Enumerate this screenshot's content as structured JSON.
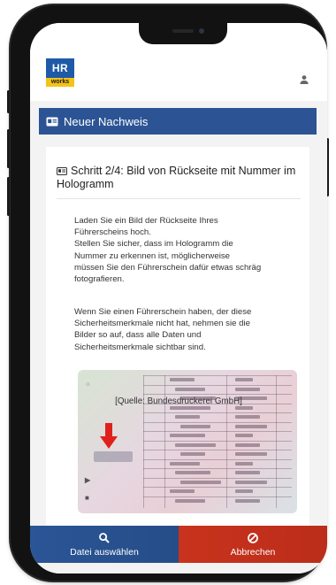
{
  "app": {
    "logo": {
      "top_text": "HR",
      "bottom_text": "works",
      "blue": "#1e5aa8",
      "yellow": "#f3c316"
    },
    "user_icon": "user-icon"
  },
  "section": {
    "title": "Neuer Nachweis",
    "icon": "id-card-icon",
    "color": "#2c5494"
  },
  "step": {
    "title": "Schritt 2/4: Bild von Rückseite mit Nummer im Hologramm",
    "icon": "id-card-icon",
    "paragraph1": "Laden Sie ein Bild der Rückseite Ihres\nFührerscheins hoch.\nStellen Sie sicher, dass im Hologramm die\nNummer zu erkennen ist, möglicherweise\nmüssen Sie den Führerschein dafür etwas schräg\nfotografieren.",
    "paragraph2": "Wenn Sie einen Führerschein haben, der diese\nSicherheitsmerkmale nicht hat, nehmen sie die\nBilder so auf, dass alle Daten und\nSicherheitsmerkmale sichtbar sind.",
    "image": "license-back-image",
    "caption": "[Quelle: Bundesdruckerei GmbH]"
  },
  "buttons": {
    "file": {
      "label": "Datei auswählen",
      "icon": "search-icon",
      "color": "#2a5596"
    },
    "cancel": {
      "label": "Abbrechen",
      "icon": "cancel-icon",
      "color": "#c8331d"
    }
  }
}
